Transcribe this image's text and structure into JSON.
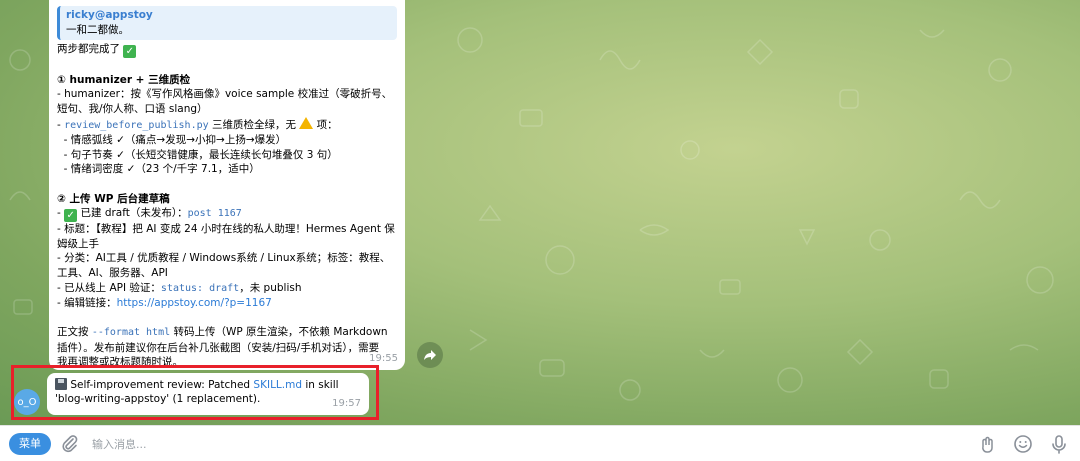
{
  "message": {
    "quote": {
      "author": "ricky@appstoy",
      "text": "一和二都做。"
    },
    "intro": "两步都完成了",
    "section1_title": "① humanizer + 三维质检",
    "s1_l1": "- humanizer：按《写作风格画像》voice sample 校准过（零破折号、",
    "s1_l2": "短句、我/你人称、口语 slang）",
    "s1_l3_prefix": "- ",
    "s1_l3_code": "review_before_publish.py",
    "s1_l3_suffix": " 三维质检全绿，无",
    "s1_l3_end": " 项：",
    "s1_l4": "  - 情感弧线 ✓（痛点→发现→小抑→上扬→爆发）",
    "s1_l5": "  - 句子节奏 ✓（长短交错健康，最长连续长句堆叠仅 3 句）",
    "s1_l6": "  - 情绪词密度 ✓（23 个/千字 7.1，适中）",
    "section2_title": "② 上传 WP 后台建草稿",
    "s2_l1_prefix": "- ",
    "s2_l1_mid": " 已建 draft（未发布）：",
    "s2_l1_code": "post 1167",
    "s2_l2": "- 标题：【教程】把 AI 变成 24 小时在线的私人助理！Hermes Agent 保",
    "s2_l3": "姆级上手",
    "s2_l4": "- 分类：AI工具 / 优质教程 / Windows系统 / Linux系统；标签：教程、",
    "s2_l5": "工具、AI、服务器、API",
    "s2_l6_prefix": "- 已从线上 API 验证：",
    "s2_l6_code": "status: draft",
    "s2_l6_suffix": "，未 publish",
    "s2_l7_prefix": "- 编辑链接：",
    "s2_l7_link": "https://appstoy.com/?p=1167",
    "p_l1_prefix": "正文按 ",
    "p_l1_code": "--format html",
    "p_l1_suffix": " 转码上传（WP 原生渲染，不依赖 Markdown",
    "p_l2": "插件）。发布前建议你在后台补几张截图（安装/扫码/手机对话），需要",
    "p_l3": "我再调整或改标题随时说。",
    "time": "19:55"
  },
  "message2": {
    "prefix": " Self-improvement review: Patched ",
    "link": "SKILL.md",
    "suffix": " in skill 'blog-writing-appstoy' (1 replacement).",
    "time": "19:57"
  },
  "avatar_text": "o_O",
  "composer": {
    "menu_label": "菜单",
    "placeholder": "输入消息..."
  },
  "colors": {
    "accent": "#3a8fe0",
    "highlight": "#e8202a",
    "check": "#3fb34f"
  },
  "icons": [
    "share-icon",
    "attach-icon",
    "bot-commands-icon",
    "emoji-icon",
    "microphone-icon",
    "floppy-disk-icon",
    "check-mark-icon",
    "warning-icon"
  ]
}
